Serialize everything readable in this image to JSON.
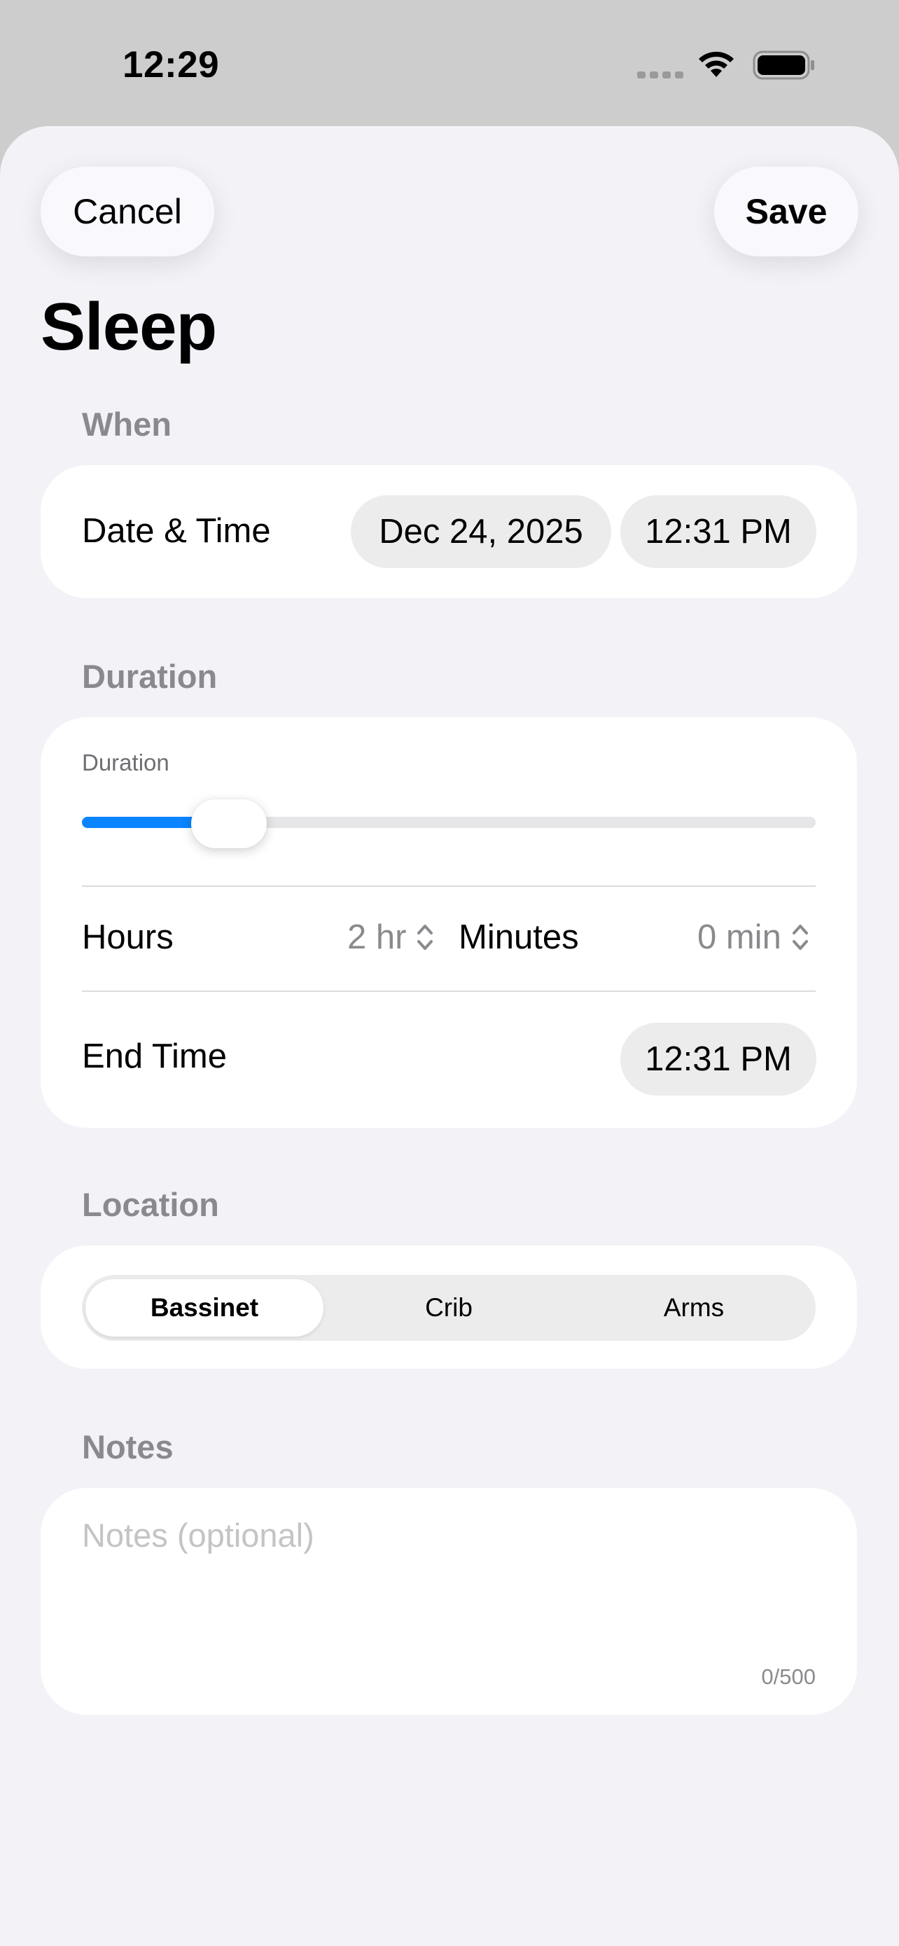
{
  "status_bar": {
    "time": "12:29"
  },
  "header": {
    "cancel_label": "Cancel",
    "save_label": "Save",
    "title": "Sleep"
  },
  "when": {
    "section_label": "When",
    "row_label": "Date & Time",
    "date": "Dec 24, 2025",
    "time": "12:31 PM"
  },
  "duration": {
    "section_label": "Duration",
    "slider_label": "Duration",
    "slider_fraction": 0.2,
    "hours_label": "Hours",
    "hours_value": "2 hr",
    "minutes_label": "Minutes",
    "minutes_value": "0 min",
    "end_time_label": "End Time",
    "end_time_value": "12:31 PM"
  },
  "location": {
    "section_label": "Location",
    "options": [
      "Bassinet",
      "Crib",
      "Arms"
    ],
    "selected": "Bassinet"
  },
  "notes": {
    "section_label": "Notes",
    "placeholder": "Notes (optional)",
    "value": "",
    "char_count": "0/500"
  },
  "colors": {
    "accent": "#0a84ff",
    "background": "#f2f2f7",
    "card": "#ffffff"
  }
}
